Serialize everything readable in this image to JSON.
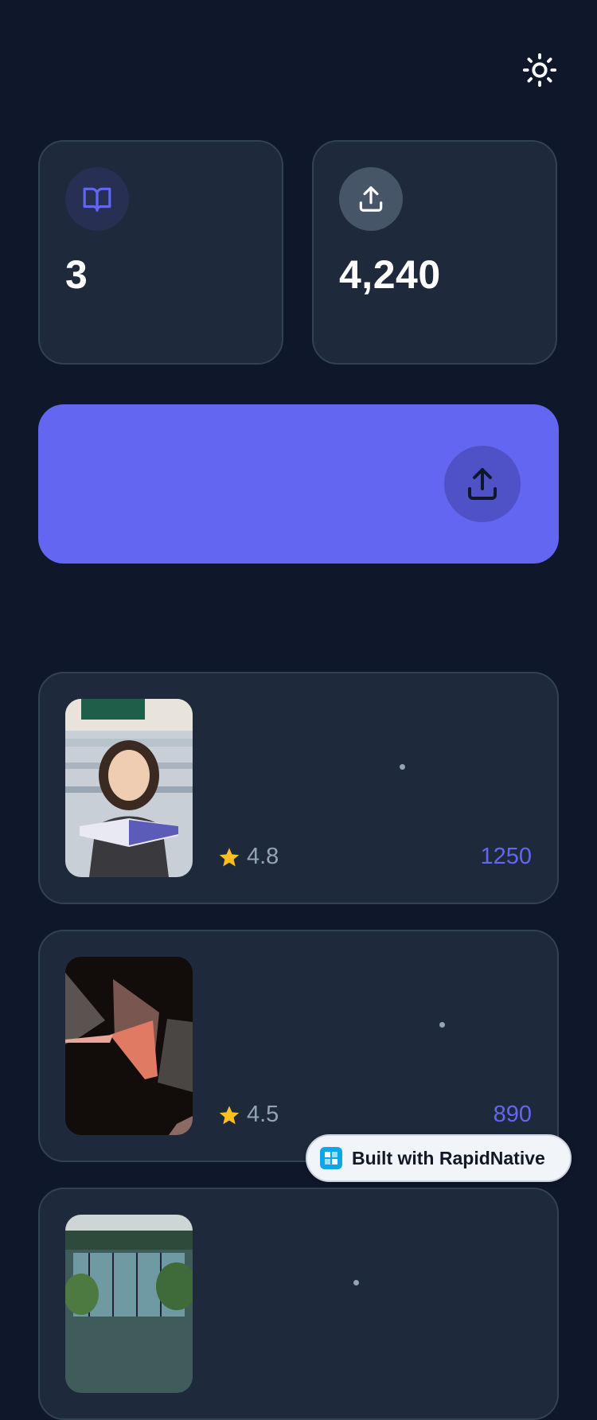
{
  "header": {
    "theme_toggle_icon": "sun-icon"
  },
  "stats": [
    {
      "icon": "book-open-icon",
      "value": "3",
      "accent": "#6366f1"
    },
    {
      "icon": "upload-icon",
      "value": "4,240",
      "accent": "#ffffff"
    }
  ],
  "upload_banner": {
    "icon": "upload-icon",
    "color": "#6366f1"
  },
  "books": [
    {
      "cover": "woman-reading-photo",
      "rating": "4.8",
      "reads": "1250"
    },
    {
      "cover": "abstract-shapes-photo",
      "rating": "4.5",
      "reads": "890"
    },
    {
      "cover": "greenhouse-photo",
      "rating": "",
      "reads": ""
    }
  ],
  "badge": {
    "label": "Built with RapidNative"
  },
  "colors": {
    "background": "#0f172a",
    "card": "#1e293b",
    "accent": "#6366f1",
    "star": "#fbbf24"
  }
}
